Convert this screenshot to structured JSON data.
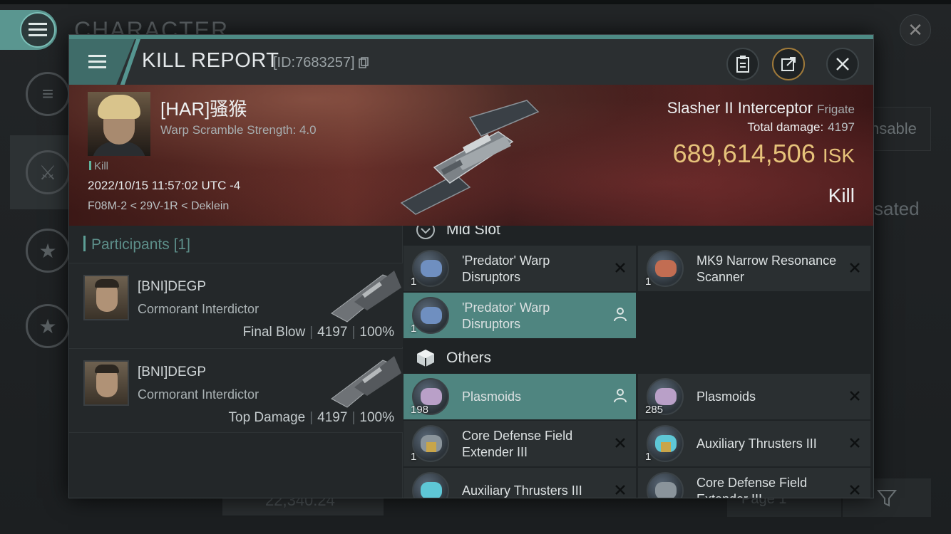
{
  "background": {
    "title": "CHARACTER",
    "right_texts": [
      "nsable",
      "sated"
    ],
    "bottom_value": "22,340.24",
    "page_label": "Page 1"
  },
  "header": {
    "title": "KILL REPORT",
    "id": "[ID:7683257]"
  },
  "victim": {
    "name": "[HAR]骚猴",
    "subtitle": "Warp Scramble Strength: 4.0",
    "tag": "Kill",
    "date": "2022/10/15 11:57:02 UTC -4",
    "location": "F08M-2 < 29V-1R < Deklein",
    "ship": "Slasher II Interceptor",
    "ship_class": "Frigate",
    "total_damage_label": "Total damage:",
    "total_damage": "4197",
    "isk_value": "689,614,506",
    "isk_unit": "ISK",
    "result": "Kill"
  },
  "participants": {
    "label": "Participants",
    "count": "[1]",
    "rows": [
      {
        "name": "[BNI]DEGP",
        "ship": "Cormorant Interdictor",
        "role": "Final Blow",
        "damage": "4197",
        "percent": "100%"
      },
      {
        "name": "[BNI]DEGP",
        "ship": "Cormorant Interdictor",
        "role": "Top Damage",
        "damage": "4197",
        "percent": "100%"
      }
    ]
  },
  "sections": {
    "mid_slot": "Mid Slot",
    "others": "Others"
  },
  "items": {
    "mid": [
      {
        "name": "'Predator' Warp Disruptors",
        "qty": "1",
        "status": "destroyed"
      },
      {
        "name": "MK9 Narrow Resonance Scanner",
        "qty": "1",
        "status": "destroyed"
      },
      {
        "name": "'Predator' Warp Disruptors",
        "qty": "1",
        "status": "dropped"
      }
    ],
    "others": [
      {
        "name": "Plasmoids",
        "qty": "198",
        "status": "dropped"
      },
      {
        "name": "Plasmoids",
        "qty": "285",
        "status": "destroyed"
      },
      {
        "name": "Core Defense Field Extender III",
        "qty": "1",
        "status": "destroyed"
      },
      {
        "name": "Auxiliary Thrusters III",
        "qty": "1",
        "status": "destroyed"
      },
      {
        "name": "Auxiliary Thrusters III",
        "qty": "",
        "status": "destroyed"
      },
      {
        "name": "Core Defense Field Extender III",
        "qty": "",
        "status": "destroyed"
      }
    ]
  },
  "colors": {
    "accent": "#4f8580",
    "isk": "#e6c27a",
    "banner": "#5a2a24"
  }
}
